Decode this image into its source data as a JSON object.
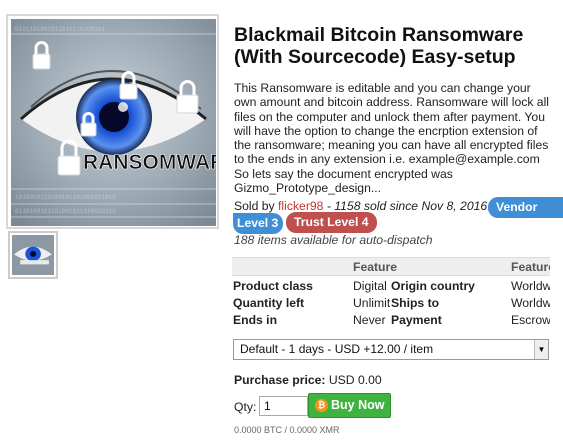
{
  "product": {
    "title": "Blackmail Bitcoin Ransomware (With Sourcecode) Easy-setup",
    "description": "This Ransomware is editable and you can change your own amount and bitcoin address. Ransomware will lock all files on the computer and unlock them after payment. You will have the option to change the encrption extension of the ransomware; meaning you can have all encrypted files to the ends in any extension i.e. example@example.com So lets say the document encrypted was Gizmo_Prototype_design...",
    "image_text": "RANSOMWARE"
  },
  "sales": {
    "sold_by_label": "Sold by",
    "vendor": "flicker98",
    "sold_count": "- 1158 sold since Nov 8, 2016",
    "vendor_level_part1": "Vendor",
    "vendor_level_part2": "Level 3",
    "trust_level": "Trust Level 4",
    "availability": "188 items available for auto-dispatch"
  },
  "features": {
    "header_col1": "Feature",
    "header_col2": "Feature",
    "rows": [
      {
        "label": "Product class",
        "value": "Digital goods",
        "label2": "Origin country",
        "value2": "Worldwide"
      },
      {
        "label": "Quantity left",
        "value": "Unlimited",
        "label2": "Ships to",
        "value2": "Worldwide"
      },
      {
        "label": "Ends in",
        "value": "Never",
        "label2": "Payment",
        "value2": "Escrow"
      }
    ]
  },
  "shipping": {
    "selected": "Default - 1 days - USD +12.00 / item"
  },
  "purchase": {
    "price_label": "Purchase price:",
    "price_value": "USD 0.00",
    "qty_label": "Qty:",
    "qty_value": "1",
    "buy_label": "Buy Now",
    "conversion": "0.0000 BTC / 0.0000 XMR"
  },
  "icons": {
    "buy": "bitcoin-icon",
    "select": "chevron-down-icon"
  }
}
